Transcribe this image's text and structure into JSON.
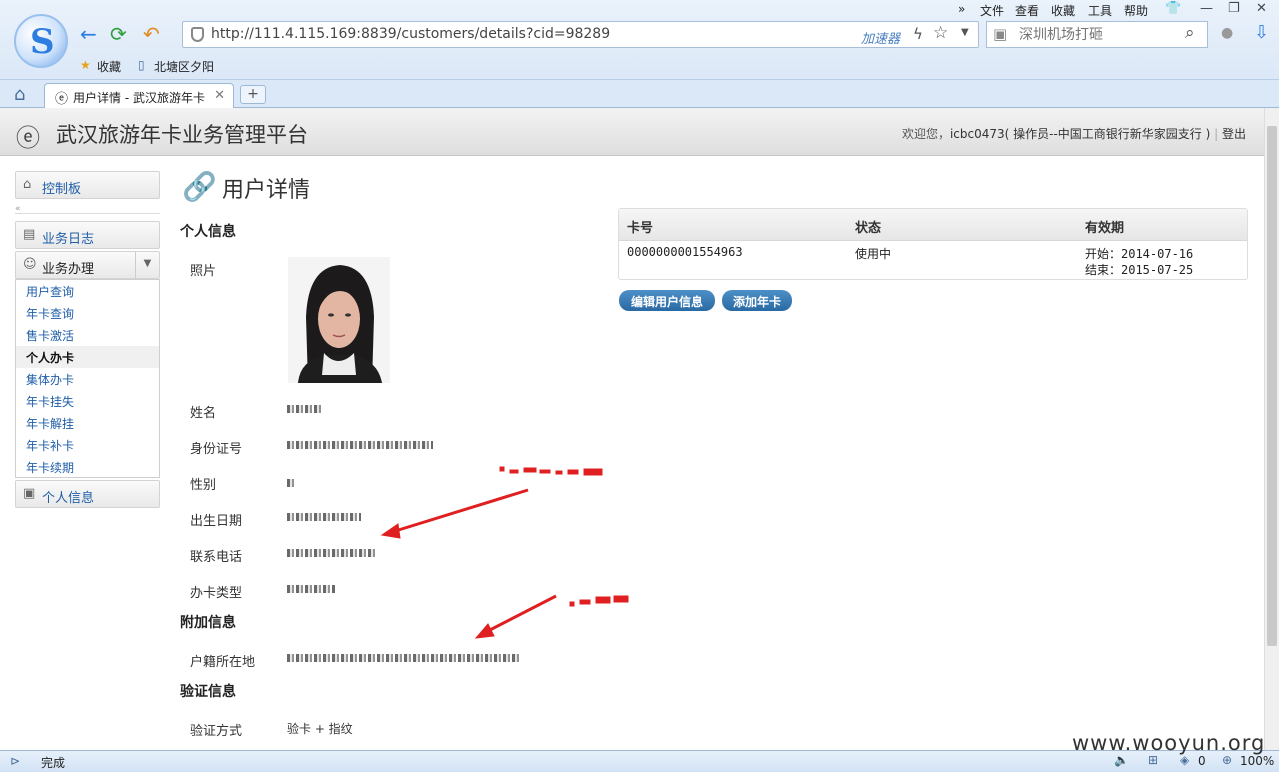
{
  "browser": {
    "url": "http://111.4.115.169:8839/customers/details?cid=98289",
    "accelerator": "加速器",
    "search_placeholder": "深圳机场打砸",
    "menu": [
      "文件",
      "查看",
      "收藏",
      "工具",
      "帮助"
    ],
    "bookmarks": {
      "favorites": "收藏",
      "item1": "北塘区夕阳"
    },
    "tab_title": "用户详情 - 武汉旅游年卡",
    "status": "完成",
    "zoom": "100%",
    "status_count": "0"
  },
  "app": {
    "title": "武汉旅游年卡业务管理平台",
    "welcome_prefix": "欢迎您，",
    "username": "icbc0473",
    "role": "( 操作员--中国工商银行新华家园支行 )",
    "logout": "登出"
  },
  "sidebar": {
    "dashboard": "控制板",
    "log": "业务日志",
    "business": "业务办理",
    "items": [
      "用户查询",
      "年卡查询",
      "售卡激活",
      "个人办卡",
      "集体办卡",
      "年卡挂失",
      "年卡解挂",
      "年卡补卡",
      "年卡续期"
    ],
    "personal": "个人信息"
  },
  "page": {
    "title": "用户详情",
    "sec_personal": "个人信息",
    "photo_label": "照片",
    "name_label": "姓名",
    "id_label": "身份证号",
    "gender_label": "性别",
    "birth_label": "出生日期",
    "phone_label": "联系电话",
    "cardtype_label": "办卡类型",
    "sec_extra": "附加信息",
    "hukou_label": "户籍所在地",
    "sec_verify": "验证信息",
    "verify_label": "验证方式",
    "verify_value": "验卡 + 指纹"
  },
  "cards": {
    "headers": [
      "卡号",
      "状态",
      "有效期"
    ],
    "rows": [
      {
        "number": "0000000001554963",
        "status": "使用中",
        "start": "开始：2014-07-16",
        "end": "结束：2015-07-25"
      }
    ]
  },
  "buttons": {
    "edit": "编辑用户信息",
    "add": "添加年卡"
  },
  "watermark": "www.wooyun.org"
}
